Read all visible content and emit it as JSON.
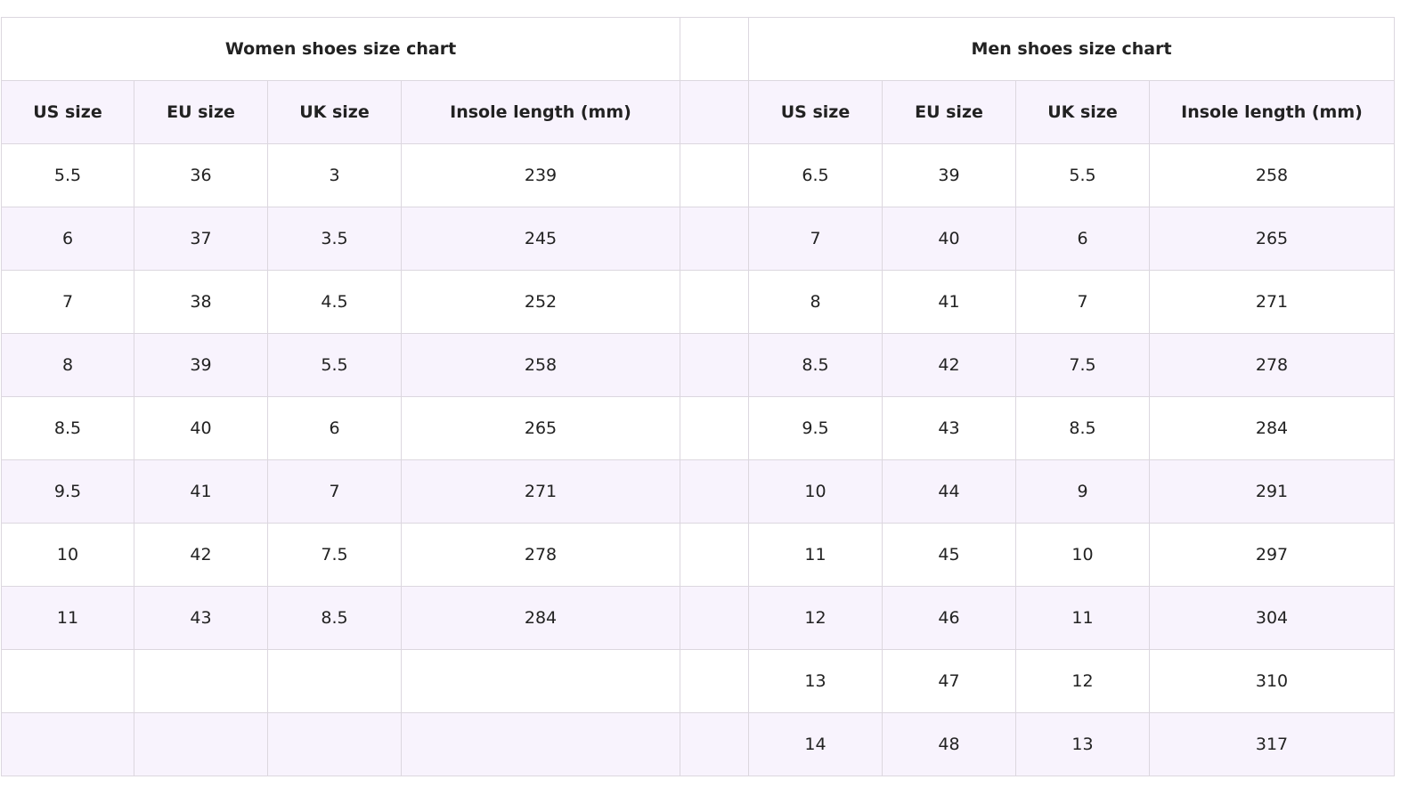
{
  "women": {
    "title": "Women shoes size chart",
    "headers": [
      "US size",
      "EU size",
      "UK size",
      "Insole length (mm)"
    ],
    "rows": [
      [
        "5.5",
        "36",
        "3",
        "239"
      ],
      [
        "6",
        "37",
        "3.5",
        "245"
      ],
      [
        "7",
        "38",
        "4.5",
        "252"
      ],
      [
        "8",
        "39",
        "5.5",
        "258"
      ],
      [
        "8.5",
        "40",
        "6",
        "265"
      ],
      [
        "9.5",
        "41",
        "7",
        "271"
      ],
      [
        "10",
        "42",
        "7.5",
        "278"
      ],
      [
        "11",
        "43",
        "8.5",
        "284"
      ],
      [
        "",
        "",
        "",
        ""
      ],
      [
        "",
        "",
        "",
        ""
      ]
    ]
  },
  "men": {
    "title": "Men shoes size chart",
    "headers": [
      "US size",
      "EU size",
      "UK size",
      "Insole length (mm)"
    ],
    "rows": [
      [
        "6.5",
        "39",
        "5.5",
        "258"
      ],
      [
        "7",
        "40",
        "6",
        "265"
      ],
      [
        "8",
        "41",
        "7",
        "271"
      ],
      [
        "8.5",
        "42",
        "7.5",
        "278"
      ],
      [
        "9.5",
        "43",
        "8.5",
        "284"
      ],
      [
        "10",
        "44",
        "9",
        "291"
      ],
      [
        "11",
        "45",
        "10",
        "297"
      ],
      [
        "12",
        "46",
        "11",
        "304"
      ],
      [
        "13",
        "47",
        "12",
        "310"
      ],
      [
        "14",
        "48",
        "13",
        "317"
      ]
    ]
  },
  "colors": {
    "row_shade": "#f8f3fd",
    "border": "#dcd7df",
    "text": "#222222"
  }
}
